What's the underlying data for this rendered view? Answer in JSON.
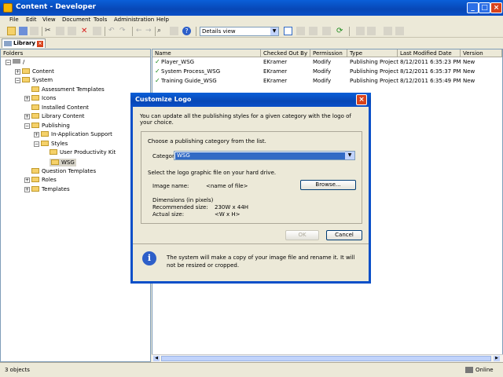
{
  "window": {
    "title": "Content - Developer"
  },
  "menu": [
    "File",
    "Edit",
    "View",
    "Document",
    "Tools",
    "Administration",
    "Help"
  ],
  "toolbar": {
    "view_select": "Details view"
  },
  "tab": {
    "label": "Library"
  },
  "folders_header": "Folders",
  "tree": {
    "root": "/",
    "items": [
      "Content",
      "System",
      "Assessment Templates",
      "Icons",
      "Installed Content",
      "Library Content",
      "Publishing",
      "In-Application Support",
      "Styles",
      "User Productivity Kit",
      "WSG",
      "Question Templates",
      "Roles",
      "Templates"
    ]
  },
  "columns": [
    "Name",
    "Checked Out By",
    "Permission",
    "Type",
    "Last Modified Date",
    "Version"
  ],
  "rows": [
    {
      "name": "Player_WSG",
      "checked_out_by": "EKramer",
      "permission": "Modify",
      "type": "Publishing Project",
      "modified": "8/12/2011 6:35:23 PM",
      "version": "New"
    },
    {
      "name": "System Process_WSG",
      "checked_out_by": "EKramer",
      "permission": "Modify",
      "type": "Publishing Project",
      "modified": "8/12/2011 6:35:37 PM",
      "version": "New"
    },
    {
      "name": "Training Guide_WSG",
      "checked_out_by": "EKramer",
      "permission": "Modify",
      "type": "Publishing Project",
      "modified": "8/12/2011 6:35:49 PM",
      "version": "New"
    }
  ],
  "dialog": {
    "title": "Customize Logo",
    "intro": "You can update all the publishing styles for a given category with the logo of your choice.",
    "choose_label": "Choose a publishing category from the list.",
    "category_label": "Category:",
    "category_value": "WSG",
    "select_logo_label": "Select the logo graphic file on your hard drive.",
    "image_name_label": "Image name:",
    "image_name_value": "<name of file>",
    "browse_button": "Browse...",
    "dimensions_label": "Dimensions (in pixels)",
    "recommended_label": "Recommended size:",
    "recommended_value": "230W x 44H",
    "actual_label": "Actual size:",
    "actual_value": "<W x H>",
    "ok_button": "OK",
    "cancel_button": "Cancel",
    "info_text": "The system will make a copy of your image file and rename it. It will not be resized or cropped."
  },
  "status": {
    "objects": "3 objects",
    "online": "Online"
  }
}
